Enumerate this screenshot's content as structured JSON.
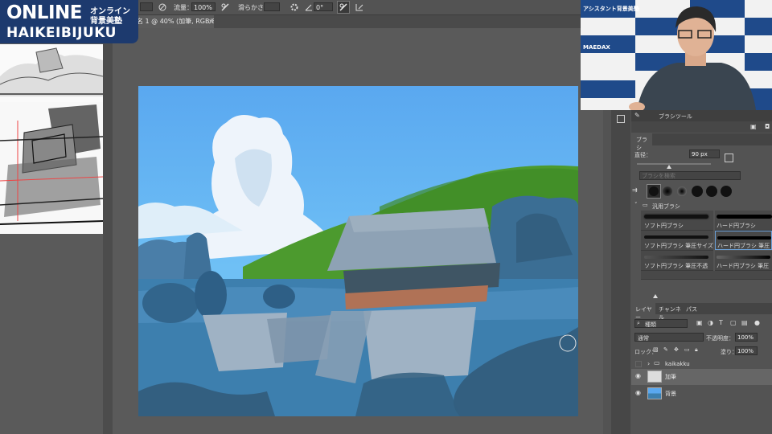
{
  "logo": {
    "main": "ONLINE",
    "sub1": "オンライン",
    "sub2": "背景美塾",
    "bottom": "HAIKEIBIJUKU"
  },
  "options_bar": {
    "flow_label": "流量：",
    "flow_value": "100%",
    "smoothing_label": "滑らかさ：",
    "angle_value": "0°"
  },
  "document_tab": {
    "title": "名 1 @ 40% (加筆, RGB/8) *"
  },
  "webcam": {
    "banner": "アシスタント背景美塾",
    "brand": "MAEDAX"
  },
  "brush_tool_panel": {
    "header": "ブラシツール",
    "tab": "ブラシ",
    "size_label": "直径：",
    "size_value": "90 px",
    "search_placeholder": "ブラシを検索",
    "folder_label": "汎用ブラシ",
    "brushes": [
      "ソフト円ブラシ",
      "ハード円ブラシ",
      "ソフト円ブラシ 筆圧サイズ",
      "ハード円ブラシ 筆圧サイ",
      "ソフト円ブラシ 筆圧不透明度",
      "ハード円ブラシ 筆圧不透"
    ]
  },
  "layers_panel": {
    "tabs": [
      "レイヤー",
      "チャンネル",
      "パス"
    ],
    "filter_label": "種類",
    "blend_mode": "通常",
    "opacity_label": "不透明度：",
    "opacity_value": "100%",
    "lock_label": "ロック：",
    "fill_label": "塗り：",
    "fill_value": "100%",
    "layers": [
      {
        "name": "kaikakku",
        "type": "group"
      },
      {
        "name": "加筆",
        "type": "layer"
      },
      {
        "name": "背景",
        "type": "layer"
      }
    ]
  },
  "colors": {
    "sky": "#5aaaf0",
    "water": "#3d7fae",
    "hill": "#4c9a2e",
    "roof": "#8ea2b5",
    "wall": "#3f5564",
    "base": "#b07256"
  }
}
